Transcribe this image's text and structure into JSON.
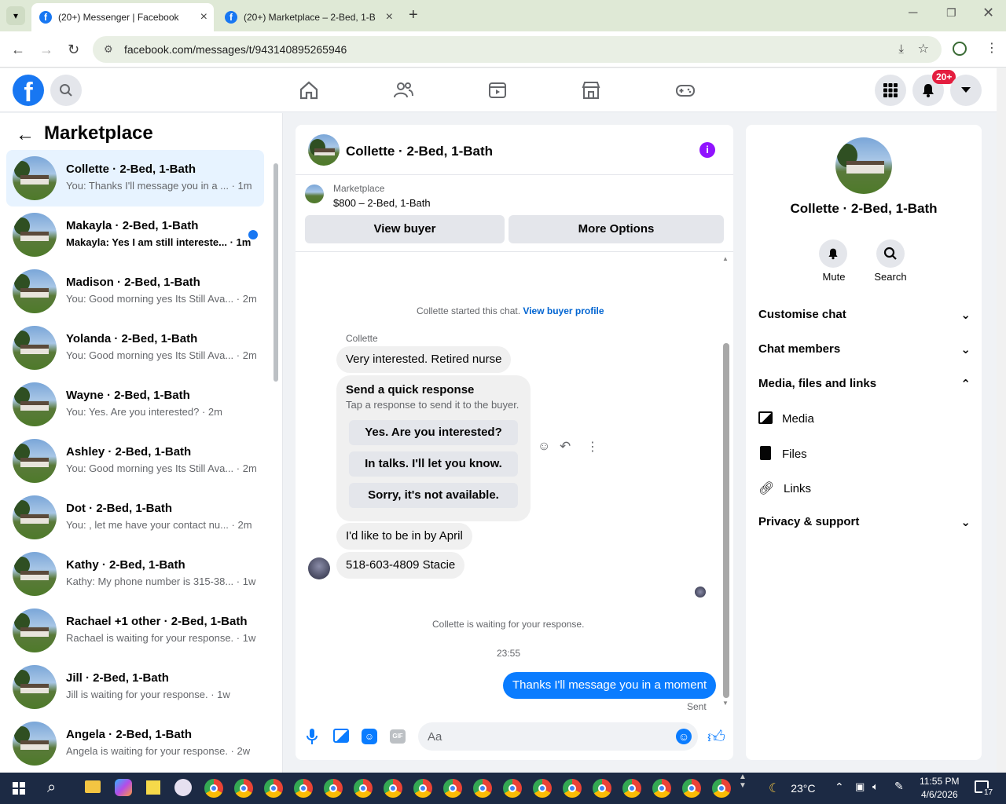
{
  "browser": {
    "tabs": [
      {
        "title": "(20+) Messenger | Facebook",
        "active": true
      },
      {
        "title": "(20+) Marketplace – 2-Bed, 1-B",
        "active": false
      }
    ],
    "url": "facebook.com/messages/t/943140895265946"
  },
  "fb_header": {
    "notification_badge": "20+",
    "nav_icons": [
      "home-icon",
      "friends-icon",
      "video-icon",
      "marketplace-icon",
      "gaming-icon"
    ]
  },
  "left_panel": {
    "title": "Marketplace",
    "conversations": [
      {
        "name": "Collette · 2-Bed, 1-Bath",
        "preview": "You: Thanks I'll message you in a ... · 1m",
        "selected": true,
        "unread": false
      },
      {
        "name": "Makayla · 2-Bed, 1-Bath",
        "preview": "Makayla: Yes I am still intereste... · 1m",
        "selected": false,
        "unread": true
      },
      {
        "name": "Madison · 2-Bed, 1-Bath",
        "preview": "You: Good morning yes Its Still Ava... · 2m",
        "selected": false,
        "unread": false
      },
      {
        "name": "Yolanda · 2-Bed, 1-Bath",
        "preview": "You: Good morning yes Its Still Ava... · 2m",
        "selected": false,
        "unread": false
      },
      {
        "name": "Wayne · 2-Bed, 1-Bath",
        "preview": "You: Yes. Are you interested? · 2m",
        "selected": false,
        "unread": false
      },
      {
        "name": "Ashley · 2-Bed, 1-Bath",
        "preview": "You: Good morning yes Its Still Ava... · 2m",
        "selected": false,
        "unread": false
      },
      {
        "name": "Dot · 2-Bed, 1-Bath",
        "preview": "You: , let me have your contact nu... · 2m",
        "selected": false,
        "unread": false
      },
      {
        "name": "Kathy · 2-Bed, 1-Bath",
        "preview": "Kathy: My phone number is 315-38... · 1w",
        "selected": false,
        "unread": false
      },
      {
        "name": "Rachael +1 other · 2-Bed, 1-Bath",
        "preview": "Rachael is waiting for your response. · 1w",
        "selected": false,
        "unread": false
      },
      {
        "name": "Jill · 2-Bed, 1-Bath",
        "preview": "Jill is waiting for your response. · 1w",
        "selected": false,
        "unread": false
      },
      {
        "name": "Angela · 2-Bed, 1-Bath",
        "preview": "Angela is waiting for your response. · 2w",
        "selected": false,
        "unread": false
      }
    ]
  },
  "chat": {
    "header_title": "Collette · 2-Bed, 1-Bath",
    "listing_source": "Marketplace",
    "listing_title": "$800 – 2-Bed, 1-Bath",
    "view_buyer_label": "View buyer",
    "more_options_label": "More Options",
    "started_text": "Collette started this chat.",
    "view_profile_link": "View buyer profile",
    "sender_name": "Collette",
    "msg1": "Very interested. Retired nurse",
    "quick_response_title": "Send a quick response",
    "quick_response_sub": "Tap a response to send it to the buyer.",
    "quick_responses": [
      "Yes. Are you interested?",
      "In talks. I'll let you know.",
      "Sorry, it's not available."
    ],
    "msg2": "I'd like to be in by April",
    "msg3": "518-603-4809 Stacie",
    "waiting_text": "Collette is waiting for your response.",
    "timestamp": "23:55",
    "my_msg": "Thanks I'll message you in a moment",
    "sent_label": "Sent",
    "composer_placeholder": "Aa"
  },
  "right_panel": {
    "name": "Collette · 2-Bed, 1-Bath",
    "mute_label": "Mute",
    "search_label": "Search",
    "sections": [
      "Customise chat",
      "Chat members",
      "Media, files and links"
    ],
    "media_items": [
      "Media",
      "Files",
      "Links"
    ],
    "privacy_label": "Privacy & support"
  },
  "taskbar": {
    "weather": "23°C",
    "time": "11:55 PM",
    "date": "4/6/2026",
    "notif_count": "17"
  },
  "colors": {
    "fb_blue": "#1877f2",
    "selected_bg": "#e7f3ff",
    "purple_info": "#9013fe"
  }
}
